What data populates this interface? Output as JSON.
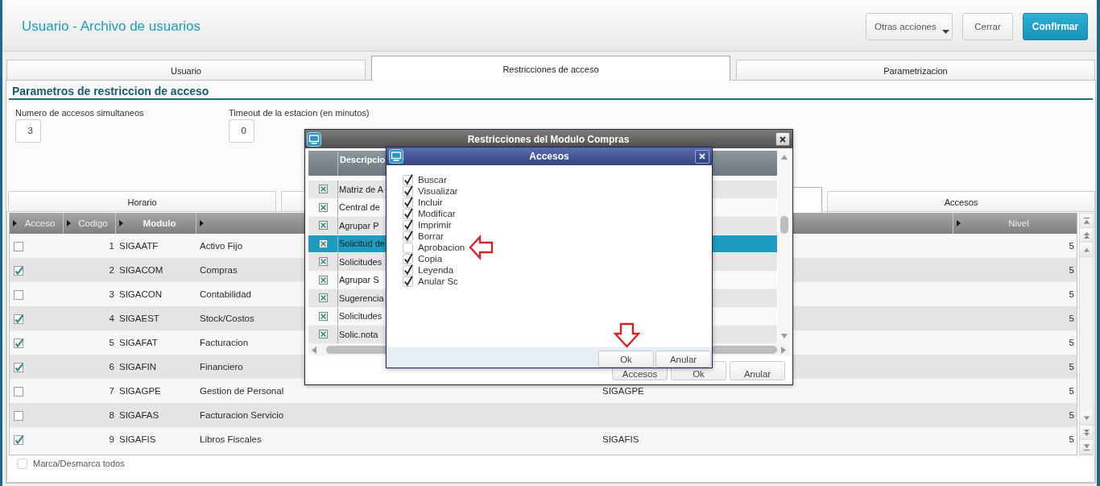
{
  "window": {
    "title": "Usuario - Archivo de usuarios"
  },
  "toolbar": {
    "buttons": [
      {
        "label": "Otras acciones",
        "kind": "menu"
      },
      {
        "label": "Cerrar",
        "kind": "close"
      },
      {
        "label": "Confirmar",
        "kind": "confirm"
      }
    ]
  },
  "tabs": [
    {
      "label": "Usuario",
      "selected": false
    },
    {
      "label": "Restricciones de acceso",
      "selected": true
    },
    {
      "label": "Parametrizacion",
      "selected": false
    }
  ],
  "section": {
    "title": "Parametros de restriccion de acceso",
    "fields": [
      {
        "label": "Numero de accesos simultaneos",
        "value": "3"
      },
      {
        "label": "Timeout de la estacion (en minutos)",
        "value": "0"
      }
    ]
  },
  "sub_tabs": [
    {
      "label": "Horario",
      "selected": false
    },
    {
      "selected": false
    },
    {
      "selected": true
    },
    {
      "label": "Accesos",
      "selected": false
    }
  ],
  "table": {
    "columns": [
      {
        "label": "Acceso",
        "marker": true,
        "highlighted": false
      },
      {
        "label": "Codigo",
        "marker": true,
        "highlighted": false
      },
      {
        "label": "Modulo",
        "marker": true,
        "highlighted": true
      },
      {
        "marker": true
      },
      {},
      {
        "label": "Nivel",
        "marker": true,
        "highlighted": false
      }
    ],
    "rows": [
      {
        "checked": false,
        "codigo": "1",
        "modulo": "SIGAATF",
        "column_4": "Activo Fijo",
        "nivel": "5"
      },
      {
        "checked": true,
        "codigo": "2",
        "modulo": "SIGACOM",
        "column_4": "Compras",
        "nivel": "5"
      },
      {
        "checked": false,
        "codigo": "3",
        "modulo": "SIGACON",
        "column_4": "Contabilidad",
        "nivel": "5"
      },
      {
        "checked": true,
        "codigo": "4",
        "modulo": "SIGAEST",
        "column_4": "Stock/Costos",
        "nivel": "5"
      },
      {
        "checked": true,
        "codigo": "5",
        "modulo": "SIGAFAT",
        "column_4": "Facturacion",
        "nivel": "5"
      },
      {
        "checked": true,
        "codigo": "6",
        "modulo": "SIGAFIN",
        "column_4": "Financiero",
        "nivel": "5"
      },
      {
        "checked": false,
        "codigo": "7",
        "modulo": "SIGAGPE",
        "column_4": "Gestion de Personal",
        "column_5": "SIGAGPE",
        "nivel": "5"
      },
      {
        "checked": false,
        "codigo": "8",
        "modulo": "SIGAFAS",
        "column_4": "Facturacion Servicio",
        "nivel": "5"
      },
      {
        "checked": true,
        "codigo": "9",
        "modulo": "SIGAFIS",
        "column_4": "Libros Fiscales",
        "column_5": "SIGAFIS",
        "nivel": "5"
      }
    ]
  },
  "select_all": {
    "label": "Marca/Desmarca todos",
    "checked": false
  },
  "module_dialog": {
    "title": "Restricciones del Modulo Compras",
    "column": "Descripcio",
    "rows": [
      {
        "text": "Matriz de A",
        "checked": true,
        "selected": false
      },
      {
        "text": "Central de",
        "checked": true,
        "selected": false
      },
      {
        "text": "Agrupar P",
        "checked": true,
        "selected": false
      },
      {
        "text": "Solicitud de",
        "checked": true,
        "selected": true
      },
      {
        "text": "Solicitudes",
        "checked": true,
        "selected": false
      },
      {
        "text": "Agrupar S",
        "checked": true,
        "selected": false
      },
      {
        "text": "Sugerencia",
        "checked": true,
        "selected": false
      },
      {
        "text": "Solicitudes",
        "checked": true,
        "selected": false
      },
      {
        "text": "Solic.nota",
        "checked": true,
        "selected": false
      }
    ],
    "buttons": [
      {
        "label": "Accesos"
      },
      {
        "label": "Ok"
      },
      {
        "label": "Anular"
      }
    ]
  },
  "access_dialog": {
    "title": "Accesos",
    "options": [
      {
        "label": "Buscar",
        "checked": true,
        "annotated": false
      },
      {
        "label": "Visualizar",
        "checked": true,
        "annotated": false
      },
      {
        "label": "Incluir",
        "checked": true,
        "annotated": false
      },
      {
        "label": "Modificar",
        "checked": true,
        "annotated": false
      },
      {
        "label": "Imprimir",
        "checked": true,
        "annotated": false
      },
      {
        "label": "Borrar",
        "checked": true,
        "annotated": false
      },
      {
        "label": "Aprobacion",
        "checked": false,
        "annotated": true
      },
      {
        "label": "Copia",
        "checked": true,
        "annotated": false
      },
      {
        "label": "Leyenda",
        "checked": true,
        "annotated": false
      },
      {
        "label": "Anular Sc",
        "checked": true,
        "annotated": false
      }
    ],
    "buttons": [
      {
        "label": "Ok",
        "annotated": true
      },
      {
        "label": "Anular",
        "annotated": false
      }
    ]
  }
}
